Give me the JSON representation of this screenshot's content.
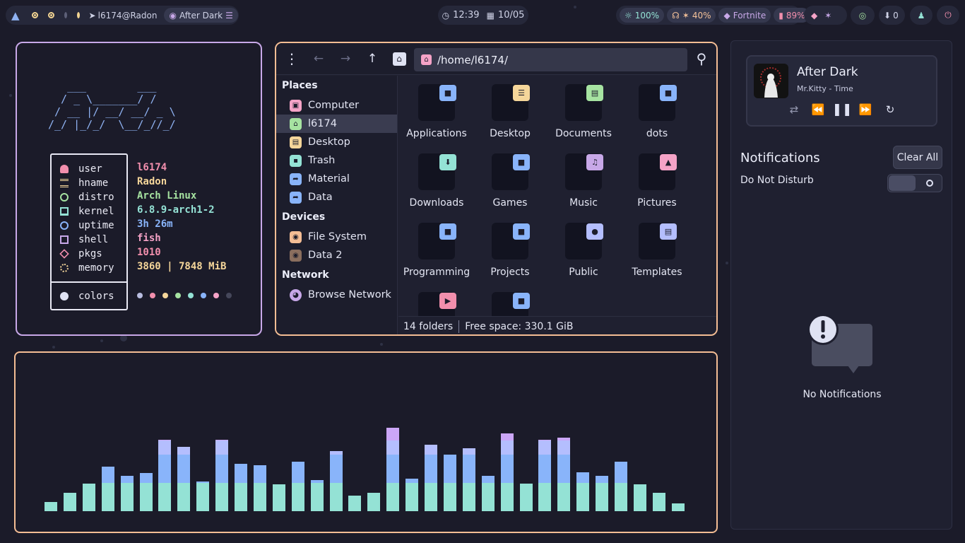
{
  "topbar": {
    "user_host": "l6174@Radon",
    "theme_label": "After Dark",
    "time": "12:39",
    "date": "10/05",
    "brightness": "100%",
    "volume": "40%",
    "game": "Fortnite",
    "battery": "89%",
    "updates": "0"
  },
  "fetch": {
    "ascii_art": "   ___        ___\n  / _ \\_______/ /\n / __ |/ __/ __/ _ \\\n/_/ |_/_/  \\__/_//_/",
    "keys": [
      "user",
      "hname",
      "distro",
      "kernel",
      "uptime",
      "shell",
      "pkgs",
      "memory"
    ],
    "values": [
      "l6174",
      "Radon",
      "Arch Linux",
      "6.8.9-arch1-2",
      "3h 26m",
      "fish",
      "1010",
      "3860 | 7848 MiB"
    ],
    "colors_label": "colors",
    "palette": [
      "#b9bde0",
      "#f28fad",
      "#f5d69a",
      "#a6e3a1",
      "#94e2d5",
      "#89b4fa",
      "#f5a3c7",
      "#45475a"
    ]
  },
  "filemanager": {
    "path": "/home/l6174/",
    "places_header": "Places",
    "places": [
      "Computer",
      "l6174",
      "Desktop",
      "Trash",
      "Material",
      "Data"
    ],
    "devices_header": "Devices",
    "devices": [
      "File System",
      "Data 2"
    ],
    "network_header": "Network",
    "network": [
      "Browse Network"
    ],
    "folders": [
      "Applications",
      "Desktop",
      "Documents",
      "dots",
      "Downloads",
      "Games",
      "Music",
      "Pictures",
      "Programming",
      "Projects",
      "Public",
      "Templates",
      "",
      ""
    ],
    "status_count": "14 folders",
    "status_free": "Free space: 330.1 GiB"
  },
  "visualizer": {
    "levels": [
      0.11,
      0.22,
      0.33,
      0.53,
      0.42,
      0.46,
      0.86,
      0.77,
      0.36,
      0.86,
      0.57,
      0.55,
      0.32,
      0.59,
      0.37,
      0.72,
      0.19,
      0.22,
      1.0,
      0.39,
      0.8,
      0.68,
      0.75,
      0.42,
      0.93,
      0.33,
      0.86,
      0.88,
      0.47,
      0.42,
      0.59,
      0.32,
      0.22,
      0.09
    ],
    "colors": {
      "low": "#94e2d5",
      "mid": "#89b4fa",
      "high": "#b4befe",
      "top": "#cba6f7"
    }
  },
  "notifications": {
    "track_title": "After Dark",
    "track_artist": "Mr.Kitty - Time",
    "title": "Notifications",
    "clear_label": "Clear All",
    "dnd_label": "Do Not Disturb",
    "empty_label": "No Notifications"
  }
}
